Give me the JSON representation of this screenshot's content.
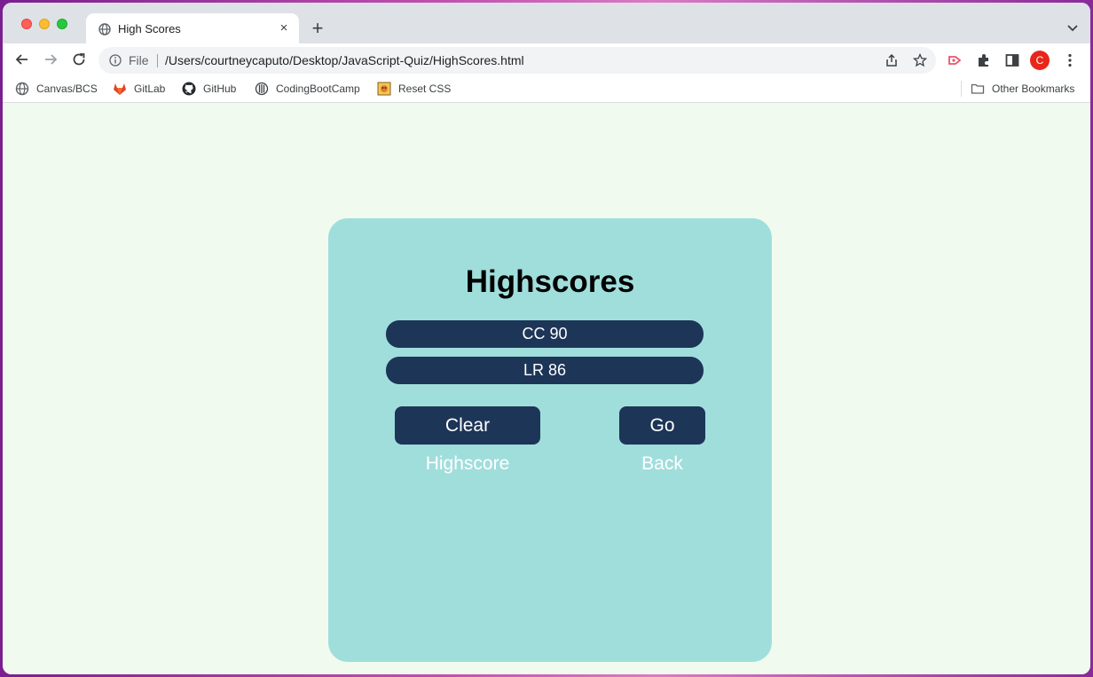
{
  "browser": {
    "tab_title": "High Scores",
    "tab_close": "×",
    "new_tab": "+",
    "file_label": "File",
    "url": "/Users/courtneycaputo/Desktop/JavaScript-Quiz/HighScores.html",
    "avatar_letter": "C",
    "bookmarks": [
      {
        "label": "Canvas/BCS",
        "icon": "globe-icon"
      },
      {
        "label": "GitLab",
        "icon": "gitlab-icon"
      },
      {
        "label": "GitHub",
        "icon": "github-icon"
      },
      {
        "label": "CodingBootCamp",
        "icon": "bootcamp-icon"
      },
      {
        "label": "Reset CSS",
        "icon": "reset-css-icon"
      }
    ],
    "other_bookmarks": "Other Bookmarks"
  },
  "page": {
    "title": "Highscores",
    "scores": [
      "CC 90",
      "LR 86"
    ],
    "clear_button": "Clear Highscore",
    "back_button": "Go Back"
  },
  "colors": {
    "page_bg": "#f1faee",
    "card_bg": "#a0dedc",
    "button_bg": "#1d3557"
  }
}
